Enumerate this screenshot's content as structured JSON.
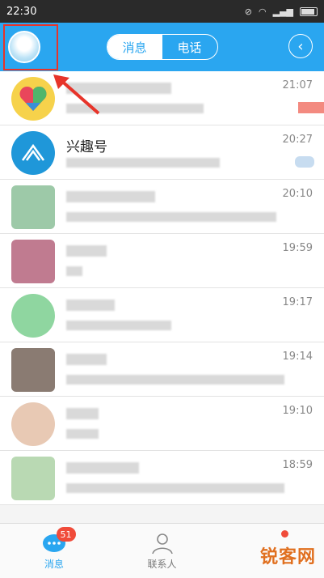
{
  "status_bar": {
    "time": "22:30"
  },
  "header": {
    "tabs": [
      {
        "label": "消息",
        "active": true
      },
      {
        "label": "电话",
        "active": false
      }
    ],
    "back_icon": "chevron-left-icon"
  },
  "conversations": [
    {
      "name": "",
      "time": "21:07",
      "avatar_color": "#f6d24b"
    },
    {
      "name": "兴趣号",
      "time": "20:27",
      "avatar_color": "#1f97d9"
    },
    {
      "name": "",
      "time": "20:10",
      "avatar_color": "#9dc9a8"
    },
    {
      "name": "",
      "time": "19:59",
      "avatar_color": "#c07b90"
    },
    {
      "name": "",
      "time": "19:17",
      "avatar_color": "#8fd6a0"
    },
    {
      "name": "",
      "time": "19:14",
      "avatar_color": "#8a7b72"
    },
    {
      "name": "",
      "time": "19:10",
      "avatar_color": "#e8c9b4"
    },
    {
      "name": "",
      "time": "18:59",
      "avatar_color": "#b9d9b3"
    }
  ],
  "tabbar": {
    "messages": {
      "label": "消息",
      "badge": "51"
    },
    "contacts": {
      "label": "联系人"
    }
  },
  "watermark": "锐客网"
}
